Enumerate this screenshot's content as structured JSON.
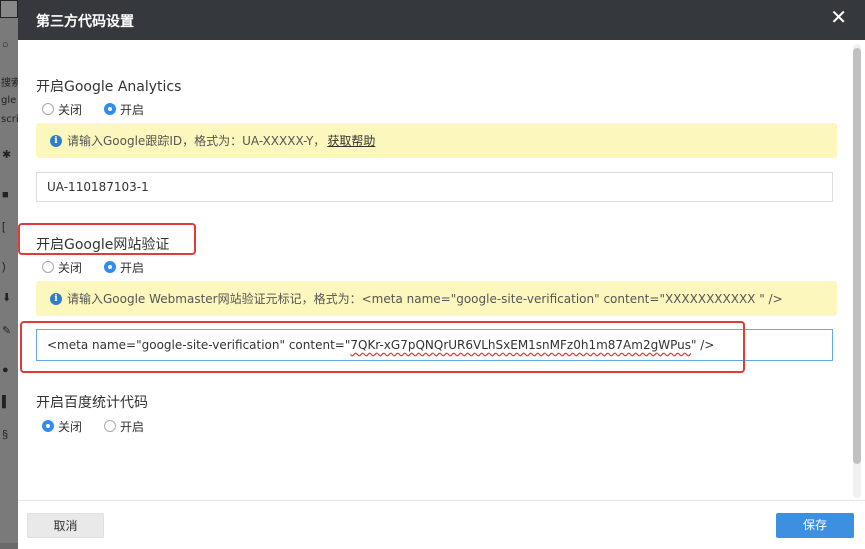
{
  "background": {
    "fragments": [
      "搜索",
      "gle",
      "script"
    ]
  },
  "dialog": {
    "title": "第三方代码设置",
    "close_glyph": "✕"
  },
  "analytics": {
    "title": "开启Google Analytics",
    "options": [
      "关闭",
      "开启"
    ],
    "selected": "开启",
    "hint": "请输入Google跟踪ID，格式为：UA-XXXXX-Y，",
    "hint_link": "获取帮助",
    "value": "UA-110187103-1"
  },
  "webmaster": {
    "title": "开启Google网站验证",
    "options": [
      "关闭",
      "开启"
    ],
    "selected": "开启",
    "hint": "请输入Google Webmaster网站验证元标记，格式为：<meta name=\"google-site-verification\" content=\"XXXXXXXXXXX \" />",
    "value_prefix": "<meta name=\"google-site-verification\" content=\"",
    "value_token": "7QKr-xG7pQNQrUR6VLhSxEM1snMFz0h1m87Am2gWPus",
    "value_suffix": "\" />"
  },
  "baidu": {
    "title": "开启百度统计代码",
    "options": [
      "关闭",
      "开启"
    ],
    "selected": "关闭"
  },
  "footer": {
    "cancel_label": "取消",
    "save_label": "保存"
  },
  "colors": {
    "header_bg": "#35393e",
    "accent": "#2e8ded",
    "highlight_border": "#e03b3b",
    "alert_bg": "#fcf8bd"
  },
  "icons": {
    "info": "info-icon",
    "close": "close-icon"
  }
}
